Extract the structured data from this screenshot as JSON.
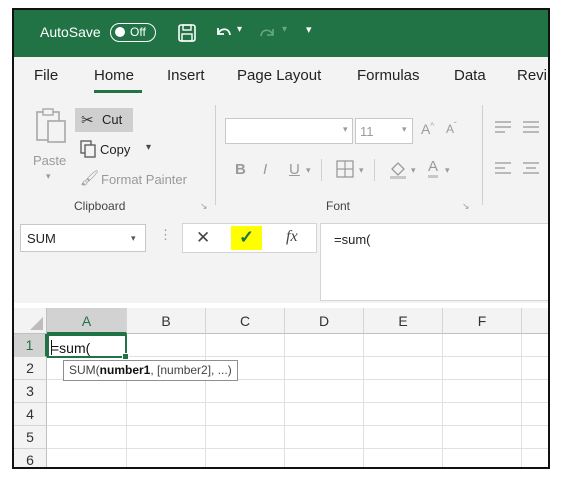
{
  "titlebar": {
    "autosave_label": "AutoSave",
    "autosave_state": "Off"
  },
  "tabs": [
    "File",
    "Home",
    "Insert",
    "Page Layout",
    "Formulas",
    "Data",
    "Revi"
  ],
  "ribbon": {
    "clipboard": {
      "paste": "Paste",
      "cut": "Cut",
      "copy": "Copy",
      "format_painter": "Format Painter",
      "group_label": "Clipboard"
    },
    "font": {
      "font_size": "11",
      "grow": "A",
      "shrink": "A",
      "bold": "B",
      "italic": "I",
      "underline": "U",
      "group_label": "Font"
    }
  },
  "formula_bar": {
    "name_box": "SUM",
    "cancel_glyph": "✕",
    "enter_glyph": "✓",
    "fx_glyph": "fx",
    "formula": "=sum("
  },
  "grid": {
    "columns": [
      "A",
      "B",
      "C",
      "D",
      "E",
      "F"
    ],
    "rows": [
      "1",
      "2",
      "3",
      "4",
      "5",
      "6"
    ],
    "active_cell_value": "=sum(",
    "tooltip": {
      "func": "SUM(",
      "arg1": "number1",
      "rest": ", [number2], ...)"
    }
  },
  "colors": {
    "excel_green": "#217346",
    "highlight": "#ffff00"
  }
}
